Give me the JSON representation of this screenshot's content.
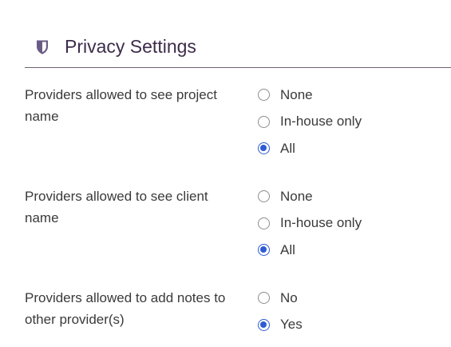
{
  "header": {
    "title": "Privacy Settings",
    "icon": "shield-icon",
    "icon_color": "#6b5c86"
  },
  "accent_color": "#2f5bd3",
  "settings": [
    {
      "label": "Providers allowed to see project name",
      "options": [
        {
          "label": "None",
          "checked": false
        },
        {
          "label": "In-house only",
          "checked": false
        },
        {
          "label": "All",
          "checked": true
        }
      ]
    },
    {
      "label": "Providers allowed to see client name",
      "options": [
        {
          "label": "None",
          "checked": false
        },
        {
          "label": "In-house only",
          "checked": false
        },
        {
          "label": "All",
          "checked": true
        }
      ]
    },
    {
      "label": "Providers allowed to add notes to other provider(s)",
      "options": [
        {
          "label": "No",
          "checked": false
        },
        {
          "label": "Yes",
          "checked": true
        }
      ]
    }
  ]
}
